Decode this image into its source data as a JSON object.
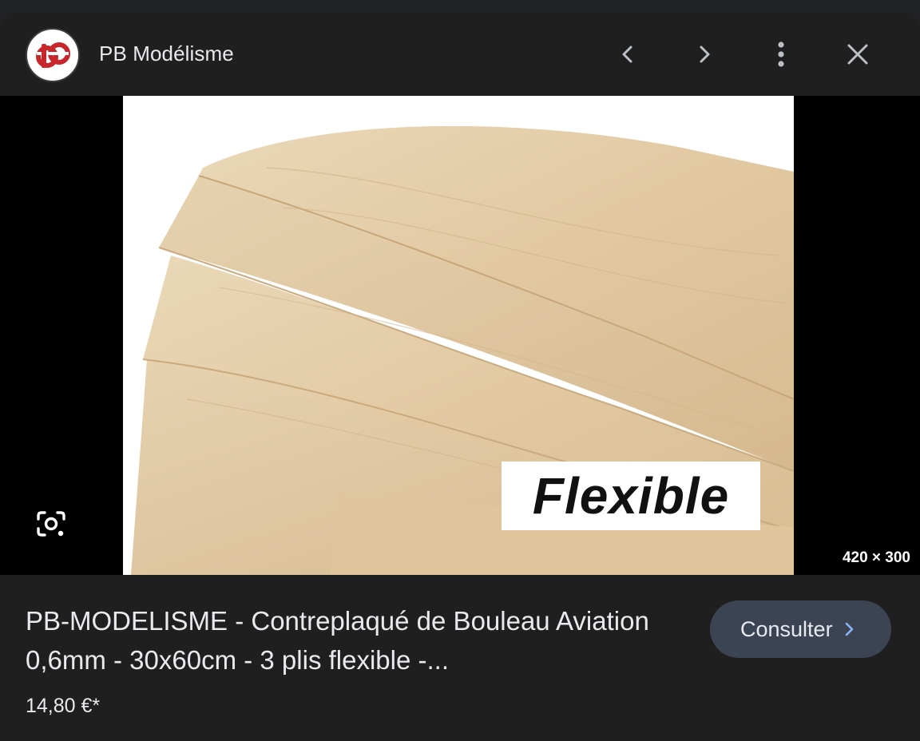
{
  "header": {
    "site_name": "PB Modélisme",
    "logo_icon": "pb-modelisme-logo-icon",
    "prev_icon": "chevron-left-icon",
    "next_icon": "chevron-right-icon",
    "more_icon": "more-vert-icon",
    "close_icon": "close-icon"
  },
  "image": {
    "overlay_text": "Flexible",
    "dimensions": "420 × 300",
    "lens_icon": "lens-search-icon"
  },
  "result": {
    "title": "PB-MODELISME - Contreplaqué de Bouleau Aviation 0,6mm - 30x60cm - 3 plis flexible -...",
    "price": "14,80 €*",
    "consult_label": "Consulter",
    "consult_icon": "chevron-right-icon"
  },
  "colors": {
    "background": "#1f1f1f",
    "button_bg": "#3c4353",
    "accent": "#8ab4f8",
    "wood": "#e3cca6",
    "logo_red": "#c8262b"
  }
}
